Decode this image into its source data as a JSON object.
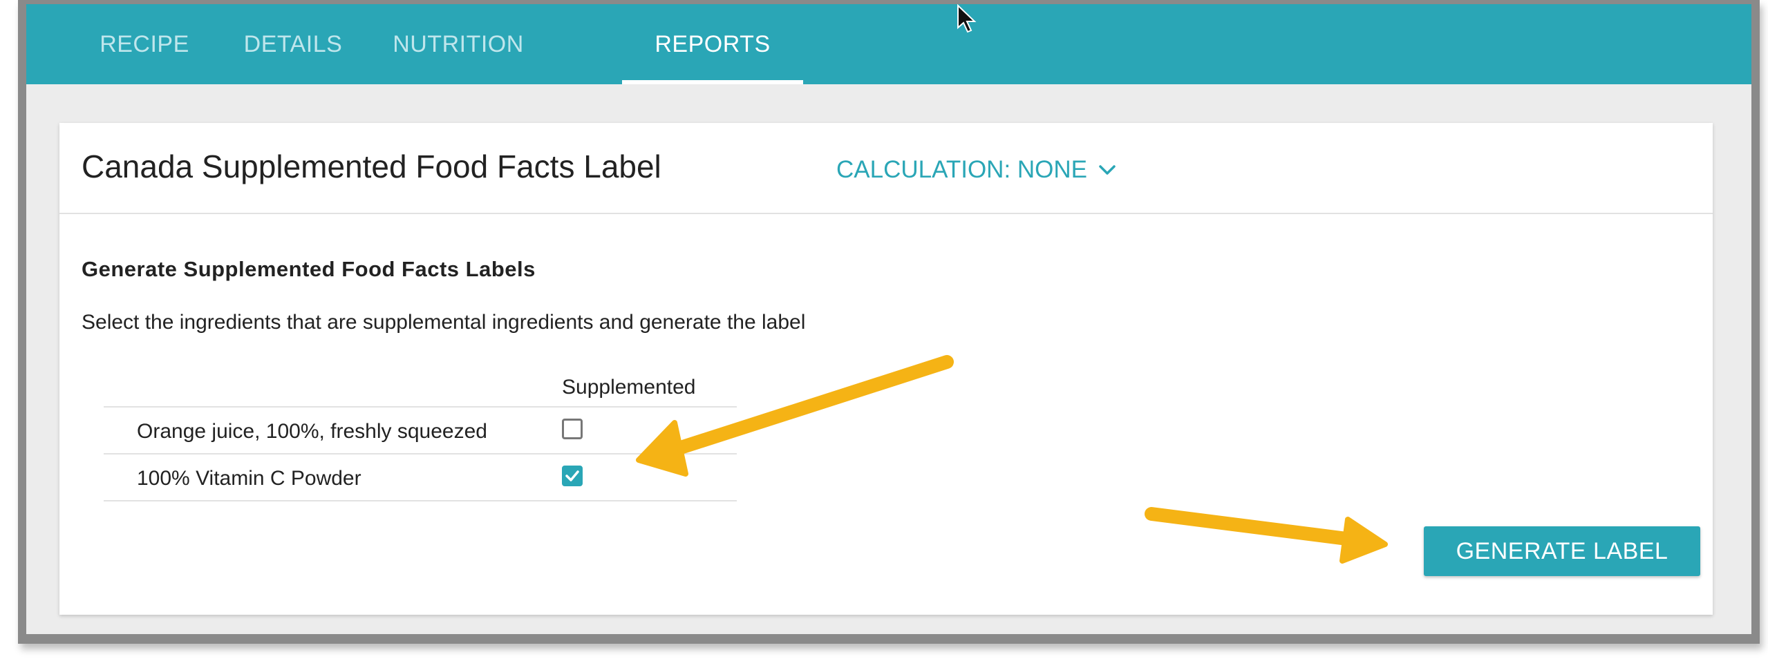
{
  "tabs": [
    {
      "label": "RECIPE",
      "active": false
    },
    {
      "label": "DETAILS",
      "active": false
    },
    {
      "label": "NUTRITION",
      "active": false
    },
    {
      "label": "REPORTS",
      "active": true
    }
  ],
  "card": {
    "title": "Canada Supplemented Food Facts Label",
    "calculation_label": "CALCULATION: NONE",
    "section_title": "Generate Supplemented Food Facts Labels",
    "section_description": "Select the ingredients that are supplemental ingredients and generate the label"
  },
  "table": {
    "column_header": "Supplemented",
    "rows": [
      {
        "name": "Orange juice, 100%, freshly squeezed",
        "supplemented": false
      },
      {
        "name": "100% Vitamin C Powder",
        "supplemented": true
      }
    ]
  },
  "generate_button_label": "GENERATE LABEL",
  "colors": {
    "accent": "#2aa6b6",
    "annotation_arrow": "#f5b315"
  },
  "icons": {
    "dropdown": "chevron-down-icon",
    "checked": "checkmark-icon",
    "cursor": "mouse-pointer-icon",
    "annotation": "arrow-annotation"
  }
}
